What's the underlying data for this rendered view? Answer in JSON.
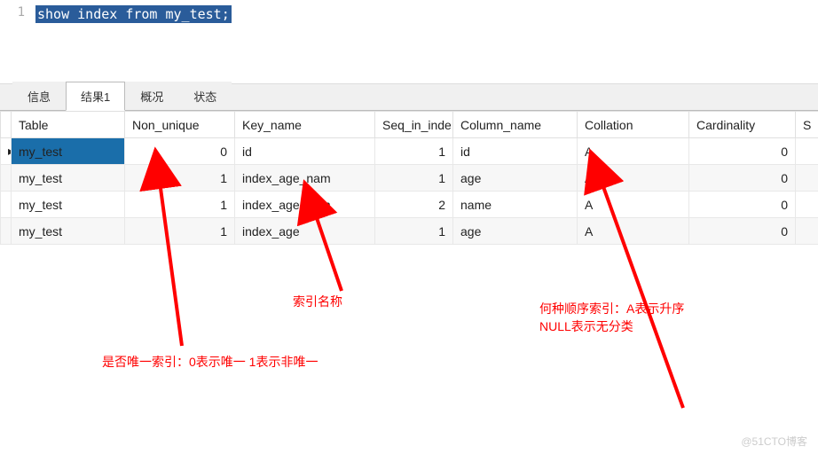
{
  "editor": {
    "line_number": "1",
    "sql": "show index from my_test;"
  },
  "tabs": {
    "info": "信息",
    "result1": "结果1",
    "profile": "概况",
    "status": "状态"
  },
  "columns": {
    "table": "Table",
    "non_unique": "Non_unique",
    "key_name": "Key_name",
    "seq_in_index": "Seq_in_inde",
    "column_name": "Column_name",
    "collation": "Collation",
    "cardinality": "Cardinality",
    "sub_part": "S"
  },
  "rows": [
    {
      "table": "my_test",
      "non_unique": "0",
      "key_name": "id",
      "seq": "1",
      "col": "id",
      "collation": "A",
      "card": "0"
    },
    {
      "table": "my_test",
      "non_unique": "1",
      "key_name": "index_age_nam",
      "seq": "1",
      "col": "age",
      "collation": "A",
      "card": "0"
    },
    {
      "table": "my_test",
      "non_unique": "1",
      "key_name": "index_age_nam",
      "seq": "2",
      "col": "name",
      "collation": "A",
      "card": "0"
    },
    {
      "table": "my_test",
      "non_unique": "1",
      "key_name": "index_age",
      "seq": "1",
      "col": "age",
      "collation": "A",
      "card": "0"
    }
  ],
  "annotations": {
    "index_name": "索引名称",
    "collation_note": "何种顺序索引：A表示升序\nNULL表示无分类",
    "non_unique_note": "是否唯一索引：0表示唯一 1表示非唯一"
  },
  "watermark": "@51CTO博客"
}
